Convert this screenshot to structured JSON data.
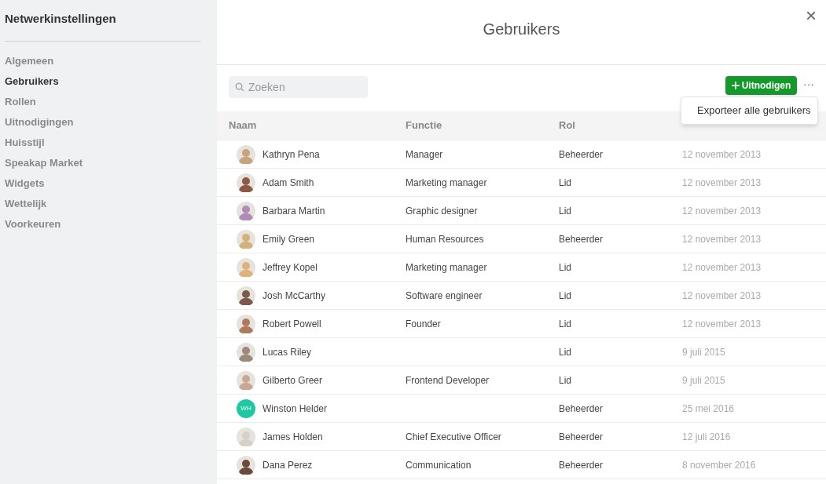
{
  "sidebar": {
    "title": "Netwerkinstellingen",
    "items": [
      {
        "label": "Algemeen",
        "selected": false
      },
      {
        "label": "Gebruikers",
        "selected": true
      },
      {
        "label": "Rollen",
        "selected": false
      },
      {
        "label": "Uitnodigingen",
        "selected": false
      },
      {
        "label": "Huisstijl",
        "selected": false
      },
      {
        "label": "Speakap Market",
        "selected": false
      },
      {
        "label": "Widgets",
        "selected": false
      },
      {
        "label": "Wettelijk",
        "selected": false
      },
      {
        "label": "Voorkeuren",
        "selected": false
      }
    ]
  },
  "dialog": {
    "title": "Gebruikers",
    "close": "×"
  },
  "toolbar": {
    "search": {
      "placeholder": "Zoeken"
    },
    "invite_button": "Uitnodigen",
    "more": "···",
    "menu": {
      "items": [
        "Exporteer alle gebruikers"
      ]
    }
  },
  "table": {
    "columns": [
      "Naam",
      "Functie",
      "Rol"
    ],
    "rows": [
      {
        "avatar": {
          "kind": "photo",
          "color": "#c9a27e"
        },
        "name": "Kathryn Pena",
        "function": "Manager",
        "role": "Beheerder",
        "since": "12 november 2013"
      },
      {
        "avatar": {
          "kind": "photo",
          "color": "#8a5a44"
        },
        "name": "Adam Smith",
        "function": "Marketing manager",
        "role": "Lid",
        "since": "12 november 2013"
      },
      {
        "avatar": {
          "kind": "photo",
          "color": "#b08ab8"
        },
        "name": "Barbara Martin",
        "function": "Graphic designer",
        "role": "Lid",
        "since": "12 november 2013"
      },
      {
        "avatar": {
          "kind": "photo",
          "color": "#d4b07a"
        },
        "name": "Emily Green",
        "function": "Human Resources",
        "role": "Beheerder",
        "since": "12 november 2013"
      },
      {
        "avatar": {
          "kind": "photo",
          "color": "#e0b27a"
        },
        "name": "Jeffrey Kopel",
        "function": "Marketing manager",
        "role": "Lid",
        "since": "12 november 2013"
      },
      {
        "avatar": {
          "kind": "photo",
          "color": "#7a5a4a"
        },
        "name": "Josh McCarthy",
        "function": "Software engineer",
        "role": "Lid",
        "since": "12 november 2013"
      },
      {
        "avatar": {
          "kind": "photo",
          "color": "#b07a5a"
        },
        "name": "Robert Powell",
        "function": "Founder",
        "role": "Lid",
        "since": "12 november 2013"
      },
      {
        "avatar": {
          "kind": "photo",
          "color": "#9a8a7a"
        },
        "name": "Lucas Riley",
        "role": "Lid",
        "since": "9 juli 2015"
      },
      {
        "avatar": {
          "kind": "photo",
          "color": "#c8a890"
        },
        "name": "Gilberto Greer",
        "function": "Frontend Developer",
        "role": "Lid",
        "since": "9 juli 2015"
      },
      {
        "avatar": {
          "kind": "initials",
          "color": "#1ec8a0",
          "initials": "WH"
        },
        "name": "Winston Helder",
        "role": "Beheerder",
        "since": "25 mei 2016"
      },
      {
        "avatar": {
          "kind": "photo",
          "color": "#d8d0c8"
        },
        "name": "James Holden",
        "function": "Chief Executive Officer",
        "role": "Beheerder",
        "since": "12 juli 2016"
      },
      {
        "avatar": {
          "kind": "photo",
          "color": "#6a4a3a"
        },
        "name": "Dana Perez",
        "function": "Communication",
        "role": "Beheerder",
        "since": "8 november 2016"
      }
    ]
  }
}
